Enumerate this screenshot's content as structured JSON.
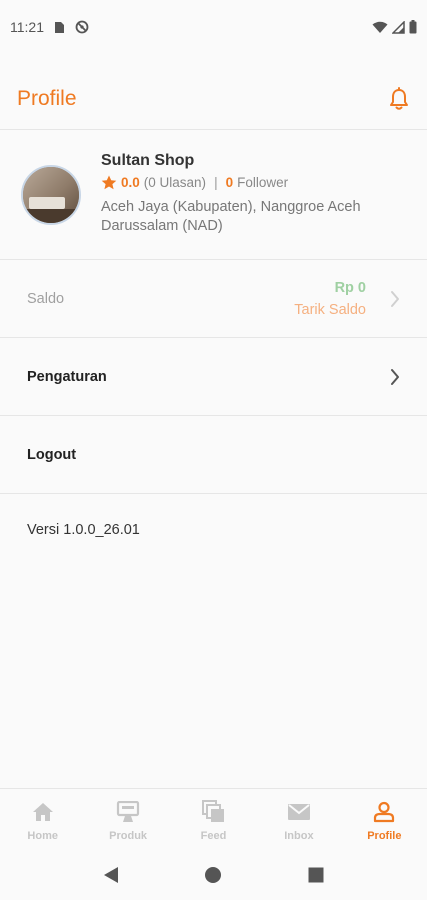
{
  "status_bar": {
    "time": "11:21",
    "icons": [
      "sim-card-icon",
      "no-disturb-icon",
      "wifi-icon",
      "signal-icon",
      "battery-icon"
    ]
  },
  "header": {
    "title": "Profile",
    "bell_icon": "bell-icon"
  },
  "profile": {
    "shop_name": "Sultan Shop",
    "rating": "0.0",
    "reviews": "(0 Ulasan)",
    "separator": "|",
    "follower_count": "0",
    "follower_label": "Follower",
    "location": "Aceh Jaya (Kabupaten), Nanggroe Aceh Darussalam (NAD)"
  },
  "saldo": {
    "label": "Saldo",
    "amount": "Rp 0",
    "withdraw_label": "Tarik Saldo"
  },
  "menu": {
    "settings_label": "Pengaturan",
    "logout_label": "Logout"
  },
  "version": "Versi 1.0.0_26.01",
  "bottom_nav": {
    "items": [
      {
        "label": "Home",
        "icon": "home-icon"
      },
      {
        "label": "Produk",
        "icon": "product-icon"
      },
      {
        "label": "Feed",
        "icon": "feed-icon"
      },
      {
        "label": "Inbox",
        "icon": "mail-icon"
      },
      {
        "label": "Profile",
        "icon": "profile-icon"
      }
    ],
    "active_index": 4
  },
  "colors": {
    "accent": "#ef7a22",
    "saldo_amount": "#9fd0a2",
    "withdraw": "#f5b080",
    "inactive_nav": "#c6c6c6"
  }
}
